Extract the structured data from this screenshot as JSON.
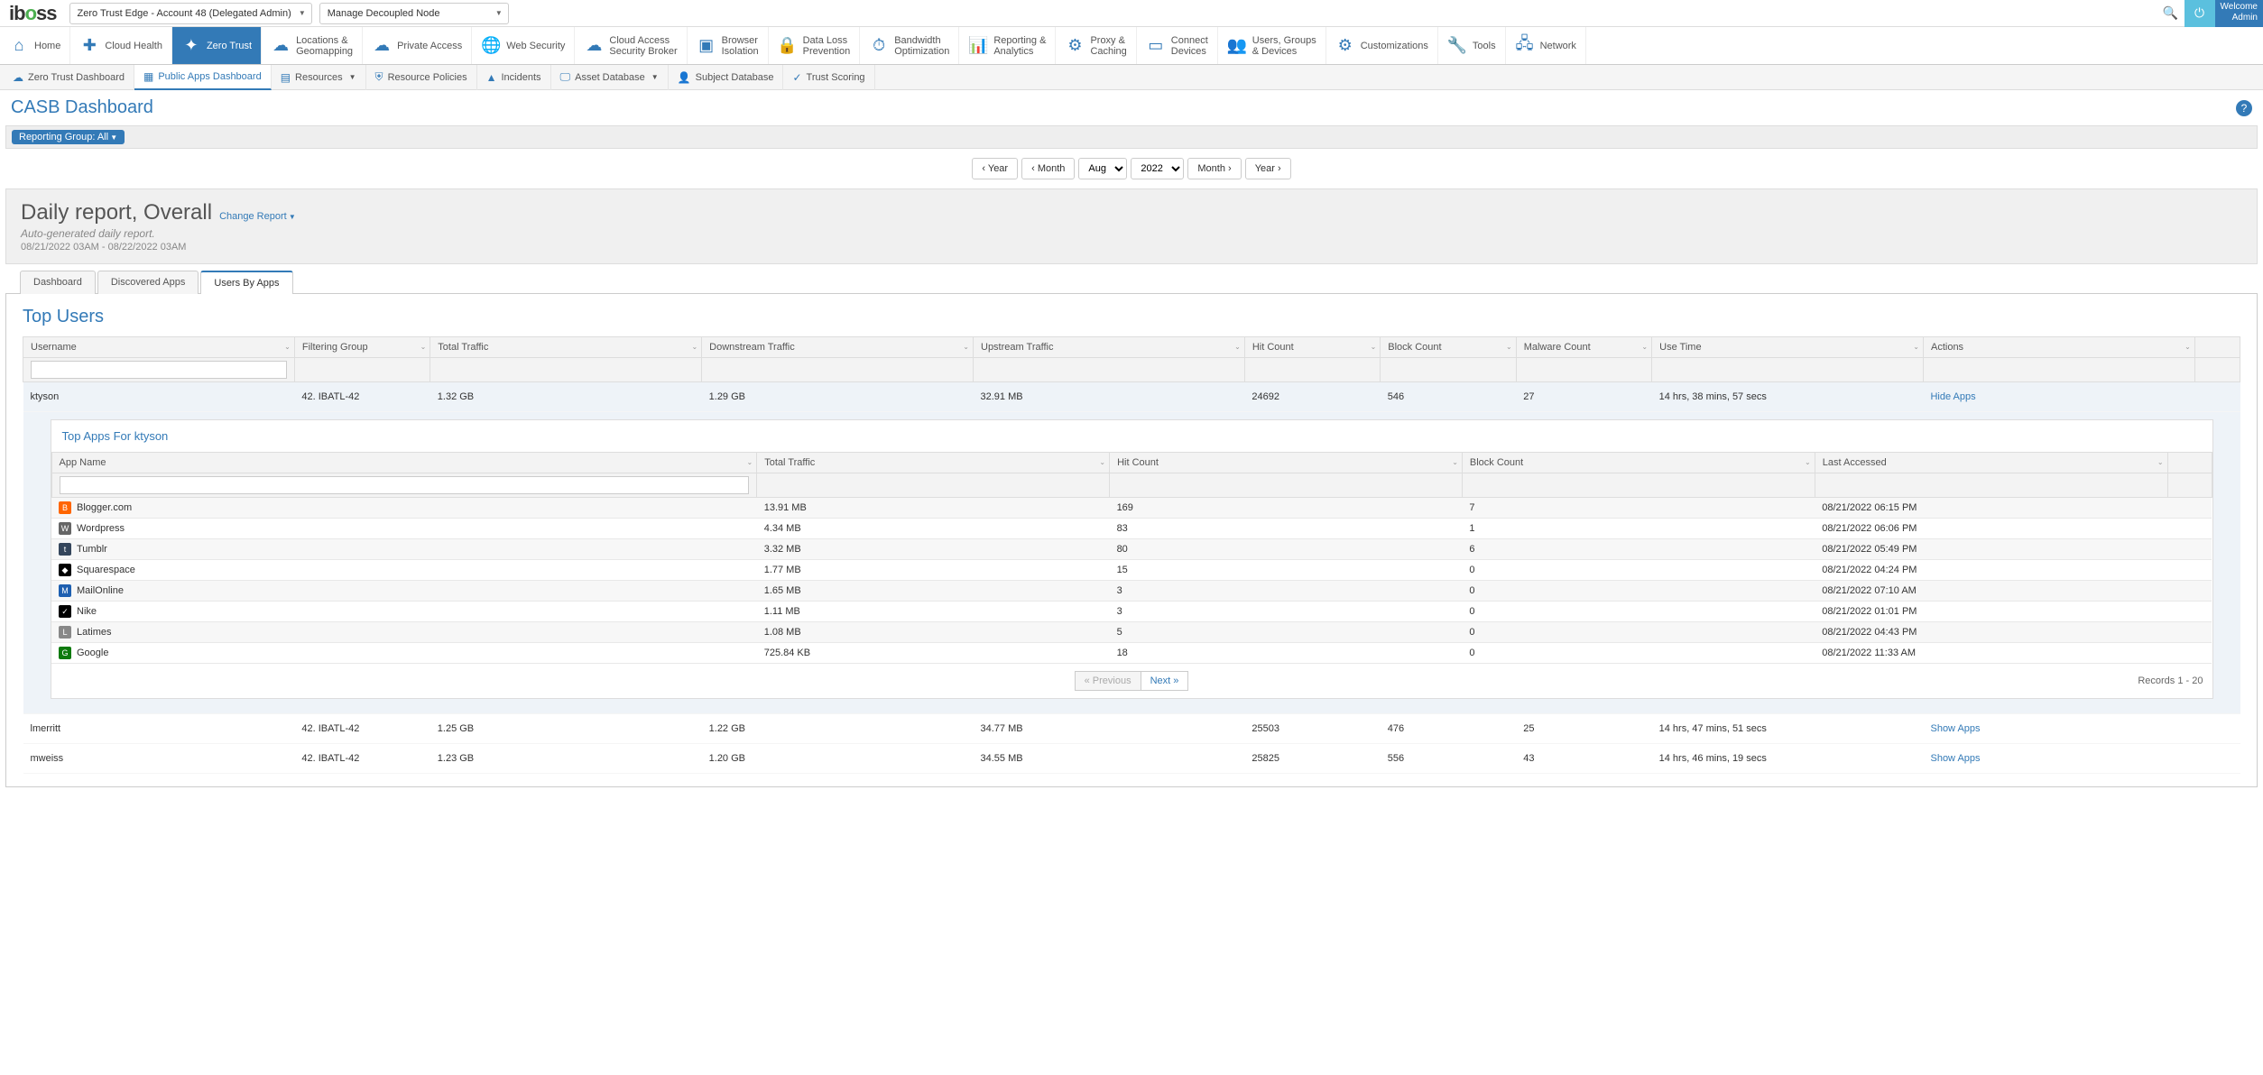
{
  "top": {
    "logo": "iboss",
    "account_dd": "Zero Trust Edge - Account 48 (Delegated Admin)",
    "node_dd": "Manage Decoupled Node",
    "welcome_line1": "Welcome",
    "welcome_line2": "Admin"
  },
  "mainnav": [
    {
      "label": "Home",
      "icon": "⌂"
    },
    {
      "label": "Cloud Health",
      "icon": "✚"
    },
    {
      "label": "Zero Trust",
      "icon": "✦",
      "active": true
    },
    {
      "label": "Locations &",
      "label2": "Geomapping",
      "icon": "☁"
    },
    {
      "label": "Private Access",
      "icon": "☁"
    },
    {
      "label": "Web Security",
      "icon": "🌐"
    },
    {
      "label": "Cloud Access",
      "label2": "Security Broker",
      "icon": "☁"
    },
    {
      "label": "Browser",
      "label2": "Isolation",
      "icon": "▣"
    },
    {
      "label": "Data Loss",
      "label2": "Prevention",
      "icon": "🔒"
    },
    {
      "label": "Bandwidth",
      "label2": "Optimization",
      "icon": "⏱"
    },
    {
      "label": "Reporting &",
      "label2": "Analytics",
      "icon": "📊"
    },
    {
      "label": "Proxy &",
      "label2": "Caching",
      "icon": "⚙"
    },
    {
      "label": "Connect",
      "label2": "Devices",
      "icon": "▭"
    },
    {
      "label": "Users, Groups",
      "label2": "& Devices",
      "icon": "👥"
    },
    {
      "label": "Customizations",
      "icon": "⚙"
    },
    {
      "label": "Tools",
      "icon": "🔧"
    },
    {
      "label": "Network",
      "icon": "🖧"
    }
  ],
  "subnav": [
    {
      "label": "Zero Trust Dashboard",
      "icon": "☁"
    },
    {
      "label": "Public Apps Dashboard",
      "icon": "▦",
      "active": true
    },
    {
      "label": "Resources",
      "icon": "▤",
      "caret": true
    },
    {
      "label": "Resource Policies",
      "icon": "⛨"
    },
    {
      "label": "Incidents",
      "icon": "▲"
    },
    {
      "label": "Asset Database",
      "icon": "🖵",
      "caret": true
    },
    {
      "label": "Subject Database",
      "icon": "👤"
    },
    {
      "label": "Trust Scoring",
      "icon": "✓"
    }
  ],
  "page": {
    "title": "CASB Dashboard",
    "filter_chip": "Reporting Group: All"
  },
  "datenav": {
    "prev_year": "‹ Year",
    "prev_month": "‹ Month",
    "month": "Aug",
    "year": "2022",
    "next_month": "Month ›",
    "next_year": "Year ›"
  },
  "report": {
    "title": "Daily report, Overall",
    "change": "Change Report",
    "sub": "Auto-generated daily report.",
    "range": "08/21/2022 03AM - 08/22/2022 03AM"
  },
  "tabs": [
    {
      "label": "Dashboard"
    },
    {
      "label": "Discovered Apps"
    },
    {
      "label": "Users By Apps",
      "active": true
    }
  ],
  "section_title": "Top Users",
  "users_cols": [
    "Username",
    "Filtering Group",
    "Total Traffic",
    "Downstream Traffic",
    "Upstream Traffic",
    "Hit Count",
    "Block Count",
    "Malware Count",
    "Use Time",
    "Actions"
  ],
  "users": [
    {
      "u": "ktyson",
      "fg": "42. IBATL-42",
      "tt": "1.32 GB",
      "dt": "1.29 GB",
      "ut": "32.91 MB",
      "hc": "24692",
      "bc": "546",
      "mc": "27",
      "use": "14 hrs, 38 mins, 57 secs",
      "act": "Hide Apps",
      "expanded": true
    },
    {
      "u": "lmerritt",
      "fg": "42. IBATL-42",
      "tt": "1.25 GB",
      "dt": "1.22 GB",
      "ut": "34.77 MB",
      "hc": "25503",
      "bc": "476",
      "mc": "25",
      "use": "14 hrs, 47 mins, 51 secs",
      "act": "Show Apps"
    },
    {
      "u": "mweiss",
      "fg": "42. IBATL-42",
      "tt": "1.23 GB",
      "dt": "1.20 GB",
      "ut": "34.55 MB",
      "hc": "25825",
      "bc": "556",
      "mc": "43",
      "use": "14 hrs, 46 mins, 19 secs",
      "act": "Show Apps"
    }
  ],
  "apps_panel_title": "Top Apps For ktyson",
  "apps_cols": [
    "App Name",
    "Total Traffic",
    "Hit Count",
    "Block Count",
    "Last Accessed"
  ],
  "apps": [
    {
      "ico_bg": "#ff6600",
      "ico_tx": "B",
      "name": "Blogger.com",
      "tt": "13.91 MB",
      "hc": "169",
      "bc": "7",
      "la": "08/21/2022 06:15 PM"
    },
    {
      "ico_bg": "#666",
      "ico_tx": "W",
      "name": "Wordpress",
      "tt": "4.34 MB",
      "hc": "83",
      "bc": "1",
      "la": "08/21/2022 06:06 PM"
    },
    {
      "ico_bg": "#35465c",
      "ico_tx": "t",
      "name": "Tumblr",
      "tt": "3.32 MB",
      "hc": "80",
      "bc": "6",
      "la": "08/21/2022 05:49 PM"
    },
    {
      "ico_bg": "#000",
      "ico_tx": "◆",
      "name": "Squarespace",
      "tt": "1.77 MB",
      "hc": "15",
      "bc": "0",
      "la": "08/21/2022 04:24 PM"
    },
    {
      "ico_bg": "#1e5fb0",
      "ico_tx": "M",
      "name": "MailOnline",
      "tt": "1.65 MB",
      "hc": "3",
      "bc": "0",
      "la": "08/21/2022 07:10 AM"
    },
    {
      "ico_bg": "#000",
      "ico_tx": "✓",
      "name": "Nike",
      "tt": "1.11 MB",
      "hc": "3",
      "bc": "0",
      "la": "08/21/2022 01:01 PM"
    },
    {
      "ico_bg": "#888",
      "ico_tx": "L",
      "name": "Latimes",
      "tt": "1.08 MB",
      "hc": "5",
      "bc": "0",
      "la": "08/21/2022 04:43 PM"
    },
    {
      "ico_bg": "#0e7a0d",
      "ico_tx": "G",
      "name": "Google",
      "tt": "725.84 KB",
      "hc": "18",
      "bc": "0",
      "la": "08/21/2022 11:33 AM"
    }
  ],
  "pager": {
    "prev": "« Previous",
    "next": "Next »",
    "records": "Records 1 - 20"
  }
}
